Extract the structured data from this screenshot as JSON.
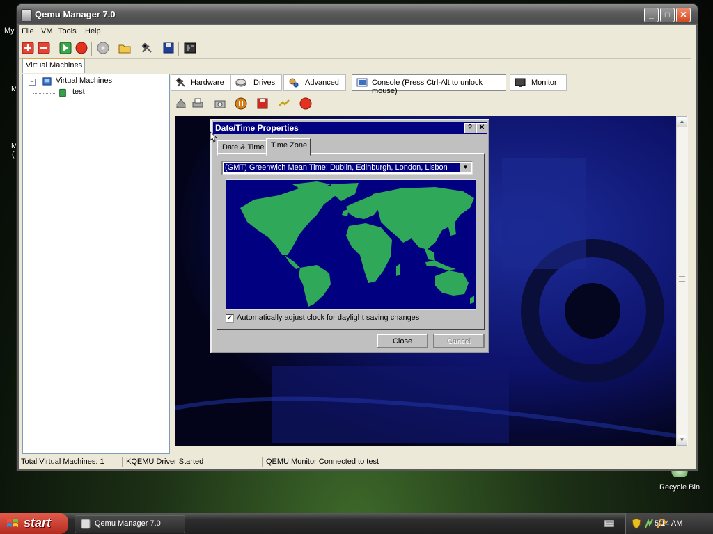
{
  "desktop": {
    "icon_label_fragments": [
      "My",
      "M",
      "M",
      "("
    ],
    "recycle_bin_label": "Recycle Bin"
  },
  "window": {
    "title": "Qemu Manager 7.0",
    "controls": {
      "minimize": "_",
      "maximize": "□",
      "close": "✕"
    }
  },
  "menu": [
    "File",
    "VM",
    "Tools",
    "Help"
  ],
  "toolbar_icons": [
    "add-vm-icon",
    "remove-vm-icon",
    "start-vm-icon",
    "stop-vm-icon",
    "disc-icon",
    "open-folder-icon",
    "settings-icon",
    "save-icon",
    "console-icon"
  ],
  "left_panel": {
    "tab_label": "Virtual Machines",
    "tree": {
      "root_label": "Virtual Machines",
      "expander": "−",
      "children": [
        "test"
      ]
    }
  },
  "right_tabs": [
    {
      "label": "Hardware",
      "icon": "hardware-icon"
    },
    {
      "label": "Drives",
      "icon": "drives-icon"
    },
    {
      "label": "Advanced",
      "icon": "advanced-icon"
    },
    {
      "label": "Console (Press Ctrl-Alt to unlock mouse)",
      "icon": "console-icon",
      "active": true
    },
    {
      "label": "Monitor",
      "icon": "monitor-icon"
    }
  ],
  "console_toolbar_icons": [
    "eject-icon",
    "print-icon",
    "screenshot-icon",
    "pause-icon",
    "save-state-icon",
    "power-icon",
    "stop-icon"
  ],
  "dialog": {
    "title": "Date/Time Properties",
    "help_btn": "?",
    "close_btn": "✕",
    "tabs": [
      "Date & Time",
      "Time Zone"
    ],
    "active_tab": "Time Zone",
    "timezone_value": "(GMT) Greenwich Mean Time: Dublin, Edinburgh, London, Lisbon",
    "dst_checked": true,
    "dst_label": "Automatically adjust clock for daylight saving changes",
    "close_button": "Close",
    "cancel_button": "Cancel"
  },
  "status": {
    "total_vms": "Total Virtual Machines: 1",
    "driver": "KQEMU Driver Started",
    "monitor": "QEMU Monitor Connected to test"
  },
  "taskbar": {
    "start_label": "start",
    "task_button": "Qemu Manager 7.0",
    "time": "5:14 AM"
  },
  "colors": {
    "dialog_titlebar": "#000080",
    "map_ocean": "#000080",
    "map_land": "#2fa85a",
    "start_button": "#c8382a"
  }
}
